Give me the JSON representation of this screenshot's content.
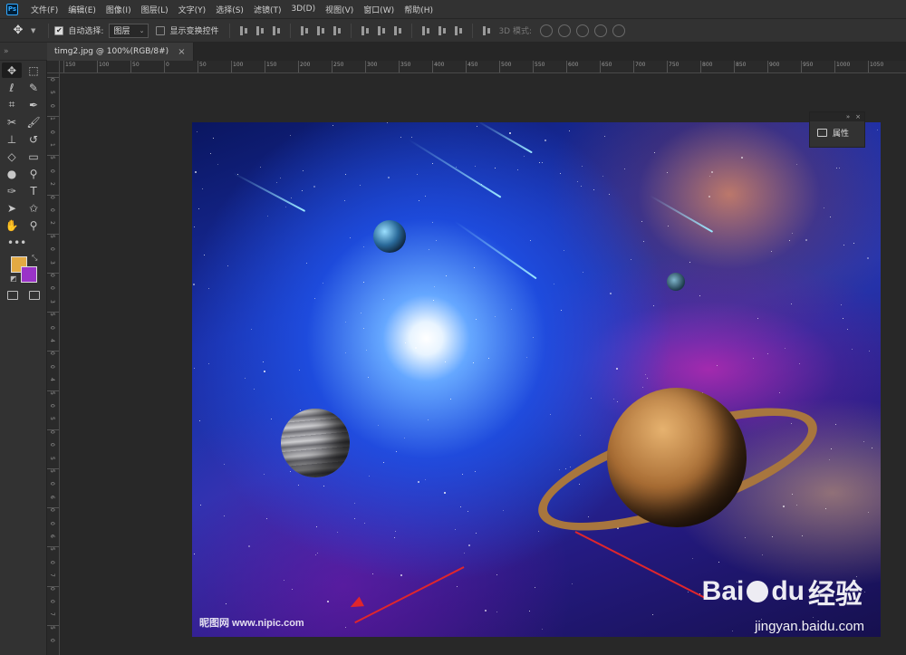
{
  "app": {
    "logo": "Ps"
  },
  "menu": [
    "文件(F)",
    "编辑(E)",
    "图像(I)",
    "图层(L)",
    "文字(Y)",
    "选择(S)",
    "滤镜(T)",
    "3D(D)",
    "视图(V)",
    "窗口(W)",
    "帮助(H)"
  ],
  "options": {
    "auto_select_label": "自动选择:",
    "auto_select_checked": true,
    "auto_select_target": "图层",
    "show_transform_label": "显示变换控件",
    "show_transform_checked": false,
    "mode3d_label": "3D 模式:"
  },
  "tab": {
    "title": "timg2.jpg @ 100%(RGB/8#)",
    "close": "×"
  },
  "ruler": {
    "top": [
      "150",
      "100",
      "50",
      "0",
      "50",
      "100",
      "150",
      "200",
      "250",
      "300",
      "350",
      "400",
      "450",
      "500",
      "550",
      "600",
      "650",
      "700",
      "750",
      "800",
      "850",
      "900",
      "950",
      "1000",
      "1050"
    ],
    "left": [
      "0",
      "5",
      "0",
      "1",
      "0",
      "1",
      "5",
      "0",
      "2",
      "0",
      "0",
      "2",
      "5",
      "0",
      "3",
      "0",
      "0",
      "3",
      "5",
      "0",
      "4",
      "0",
      "0",
      "4",
      "5",
      "0",
      "5",
      "0",
      "0",
      "5",
      "5",
      "0",
      "6",
      "0",
      "0",
      "6",
      "5",
      "0",
      "7",
      "0",
      "0",
      "7",
      "5",
      "0"
    ]
  },
  "colors": {
    "foreground": "#e3aa43",
    "background": "#9a33c8",
    "accent_arrow": "#e0262c"
  },
  "tools": [
    "move-tool",
    "marquee-tool",
    "lasso-tool",
    "quick-select-tool",
    "crop-tool",
    "eyedropper-tool",
    "healing-tool",
    "brush-tool",
    "stamp-tool",
    "history-brush-tool",
    "eraser-tool",
    "gradient-tool",
    "blur-tool",
    "dodge-tool",
    "pen-tool",
    "type-tool",
    "path-select-tool",
    "shape-tool",
    "hand-tool",
    "zoom-tool"
  ],
  "tool_more": "•••",
  "panel": {
    "title": "属性",
    "collapse": "»",
    "close": "×"
  },
  "watermarks": {
    "left": "昵图网 www.nipic.com",
    "baidu": "Bai",
    "baidu_du": "du",
    "baidu_cn": "经验",
    "site": "jingyan.baidu.com"
  }
}
